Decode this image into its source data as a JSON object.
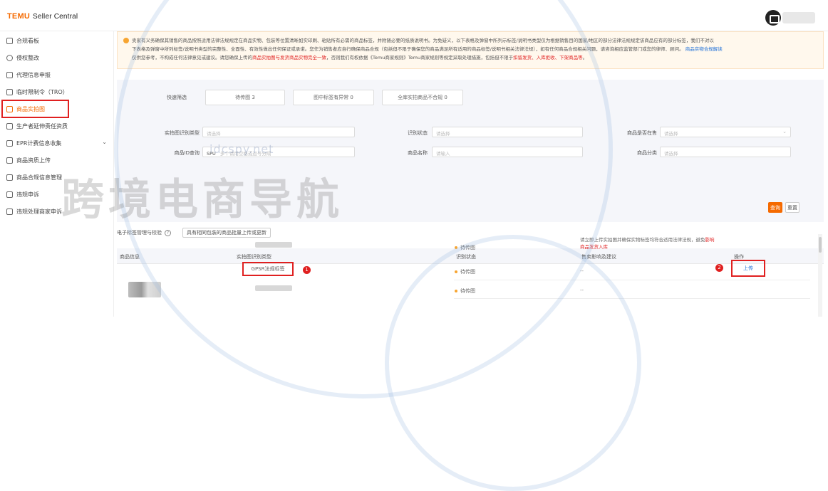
{
  "header": {
    "logo": "TEMU",
    "logo_sub": "Seller Central"
  },
  "sidebar": {
    "items": [
      {
        "label": "合规看板",
        "icon": "checklist-icon"
      },
      {
        "label": "侵权整改",
        "icon": "alert-circle-icon"
      },
      {
        "label": "代理信息申报",
        "icon": "user-icon"
      },
      {
        "label": "临时限制令（TRO）",
        "icon": "document-icon"
      },
      {
        "label": "商品实拍图",
        "icon": "image-icon"
      },
      {
        "label": "生产者延伸责任资质",
        "icon": "certificate-icon"
      },
      {
        "label": "EPR计费信息收集",
        "icon": "billing-icon"
      },
      {
        "label": "商品资质上传",
        "icon": "upload-icon"
      },
      {
        "label": "商品合规信息管理",
        "icon": "folder-icon"
      },
      {
        "label": "违规申诉",
        "icon": "appeal-icon"
      },
      {
        "label": "违规处理商家申诉",
        "icon": "shop-icon"
      }
    ]
  },
  "notice": {
    "line1": "卖家有义务确保其销售的商品按照适用法律法规规定在商品实物、包装等位置清晰如实印刷、粘贴所有必需的商品标签，并附随必要的纸质说明书。为免疑义，以下表格及弹窗中所列示标签/说明书类型仅为根据销售目的国家/地区的部分法律法规规定该商品应有的部分标签，我们不对以",
    "line2": "下表格及弹窗中所列标签/说明书类型的完整性、全面性、有效性做出任何保证或承诺。您作为销售者应自行确保商品合规（包括但不限于确保您的商品满足所有适用的商品标签/说明书相关法律法规），如有任何商品合规相关问题，请咨询相应监管部门或您的律师、顾问。",
    "link1": "商品实物合规解读",
    "line3": "仅供您参考，不构成任何法律意见或建议。请您确保上传的",
    "red1": "商品实拍图与发货商品实物完全一致",
    "line3b": "，否则我们有权依据《Temu商家规则》Temu商家规则等规定采取处理措施，包括但不限于",
    "red2": "扣留发货、入库拒收、下架商品等",
    "line3c": "。"
  },
  "quick_filter": {
    "label": "快速筛选",
    "buttons": [
      "待传图 3",
      "图中标签有异常 0",
      "全库实拍商品不合规 0"
    ]
  },
  "filters": {
    "photo_type": {
      "label": "实拍图识别类型",
      "placeholder": "请选择"
    },
    "recog_status": {
      "label": "识别状态",
      "placeholder": "请选择"
    },
    "in_stock": {
      "label": "商品是否在售",
      "placeholder": "请选择"
    },
    "product_query": {
      "label": "商品ID查询",
      "value": "SPU",
      "placeholder": "多个请用空格或逗号分隔"
    },
    "product_name": {
      "label": "商品名称",
      "placeholder": "请输入"
    },
    "category": {
      "label": "商品分类",
      "placeholder": "请选择"
    },
    "query_button": "查询",
    "reset_button": "重置"
  },
  "toolbar": {
    "check_label": "电子标签管理与校验",
    "help": "?",
    "upload_batch": "具有相同包装的商品批量上传或更新"
  },
  "table": {
    "headers": [
      "商品信息",
      "实拍图识别类型",
      "识别状态",
      "售卖影响及建议",
      "操作"
    ],
    "gps_label": "GPSR法规标签",
    "status": [
      "待传图",
      "待传图",
      "待传图"
    ],
    "advice_pre": "请立即上传实拍图并确保实物标签均符合适用法律法规，避免",
    "advice_link": "影响商品发货入库",
    "dash": "--",
    "upload_action": "上传"
  },
  "annotations": {
    "badge1": "1",
    "badge2": "2"
  },
  "watermark": {
    "text": "跨境电商导航",
    "url": "idcspy.net"
  },
  "colors": {
    "brand": "#f56a00",
    "highlight": "#e02020",
    "link": "#1d6fd8"
  }
}
